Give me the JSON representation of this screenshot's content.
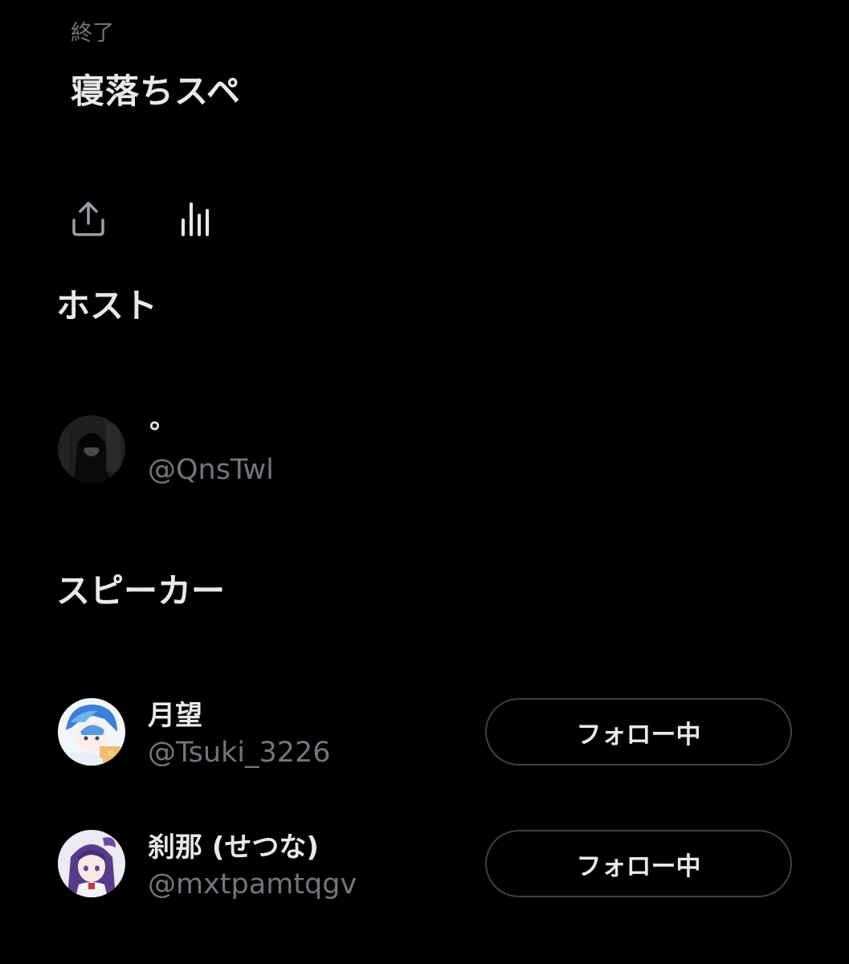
{
  "space": {
    "status": "終了",
    "title": "寝落ちスペ"
  },
  "actions": {
    "share_icon": "share-icon",
    "analytics_icon": "analytics-icon"
  },
  "sections": {
    "host_heading": "ホスト",
    "speakers_heading": "スピーカー"
  },
  "host": {
    "name": "°",
    "handle": "@QnsTwl"
  },
  "speakers": [
    {
      "name": "月望",
      "handle": "@Tsuki_3226",
      "follow_label": "フォロー中"
    },
    {
      "name": "刹那 (せつな)",
      "handle": "@mxtpamtqgv",
      "follow_label": "フォロー中"
    }
  ],
  "colors": {
    "background": "#000000",
    "primary_text": "#e7e9ea",
    "secondary_text": "#71767b",
    "button_border": "#3e4144"
  }
}
